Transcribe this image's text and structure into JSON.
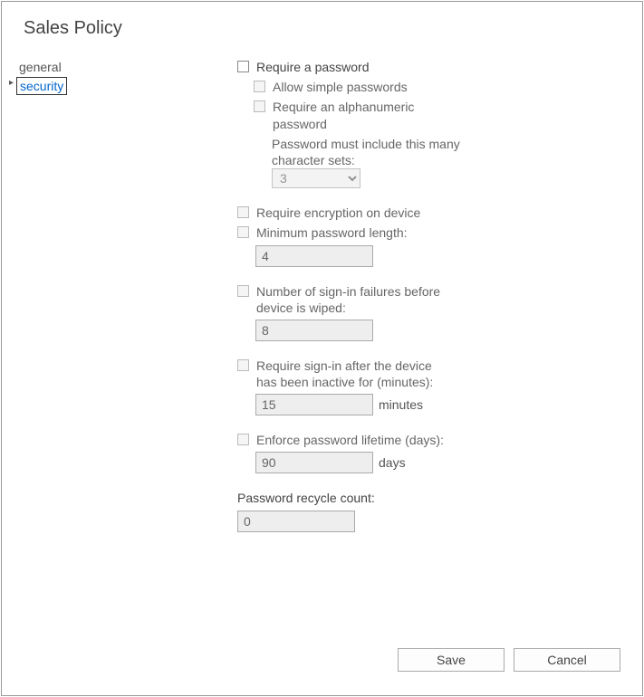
{
  "page_title": "Sales Policy",
  "nav": {
    "general": "general",
    "security": "security"
  },
  "security": {
    "require_password": "Require a password",
    "allow_simple": "Allow simple passwords",
    "require_alnum": "Require an alphanumeric password",
    "charset_desc": "Password must include this many character sets:",
    "charset_value": "3",
    "require_encryption": "Require encryption on device",
    "min_length_label": "Minimum password length:",
    "min_length_value": "4",
    "failures_label": "Number of sign-in failures before device is wiped:",
    "failures_value": "8",
    "inactive_label": "Require sign-in after the device has been inactive for (minutes):",
    "inactive_value": "15",
    "inactive_unit": "minutes",
    "lifetime_label": "Enforce password lifetime (days):",
    "lifetime_value": "90",
    "lifetime_unit": "days",
    "recycle_label": "Password recycle count:",
    "recycle_value": "0"
  },
  "buttons": {
    "save": "Save",
    "cancel": "Cancel"
  }
}
